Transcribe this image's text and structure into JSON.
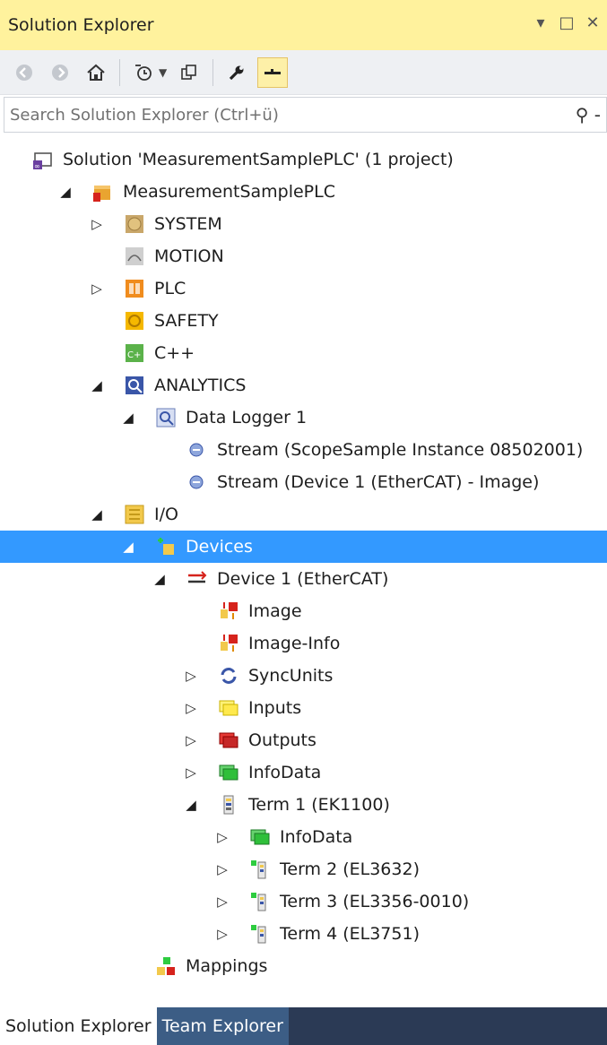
{
  "window": {
    "title": "Solution Explorer",
    "controls": [
      "▾",
      "□",
      "✕"
    ]
  },
  "search": {
    "placeholder": "Search Solution Explorer (Ctrl+ü)"
  },
  "tree": [
    {
      "label": "Solution 'MeasurementSamplePLC' (1 project)",
      "level": 0,
      "expander": "",
      "icon": "solution-icon"
    },
    {
      "label": "MeasurementSamplePLC",
      "level": 1,
      "expander": "◢",
      "icon": "project-icon"
    },
    {
      "label": "SYSTEM",
      "level": 2,
      "expander": "▷",
      "icon": "system-icon"
    },
    {
      "label": "MOTION",
      "level": 2,
      "expander": "",
      "icon": "motion-icon"
    },
    {
      "label": "PLC",
      "level": 2,
      "expander": "▷",
      "icon": "plc-icon"
    },
    {
      "label": "SAFETY",
      "level": 2,
      "expander": "",
      "icon": "safety-icon"
    },
    {
      "label": "C++",
      "level": 2,
      "expander": "",
      "icon": "cpp-icon"
    },
    {
      "label": "ANALYTICS",
      "level": 2,
      "expander": "◢",
      "icon": "analytics-icon"
    },
    {
      "label": "Data Logger 1",
      "level": 3,
      "expander": "◢",
      "icon": "data-logger-icon"
    },
    {
      "label": "Stream (ScopeSample Instance 08502001)",
      "level": 4,
      "expander": "",
      "icon": "stream-icon"
    },
    {
      "label": "Stream (Device 1 (EtherCAT) - Image)",
      "level": 4,
      "expander": "",
      "icon": "stream-icon"
    },
    {
      "label": "I/O",
      "level": 2,
      "expander": "◢",
      "icon": "io-icon"
    },
    {
      "label": "Devices",
      "level": 3,
      "expander": "◢",
      "icon": "devices-icon",
      "selected": true
    },
    {
      "label": "Device 1 (EtherCAT)",
      "level": 4,
      "expander": "◢",
      "icon": "ethercat-device-icon"
    },
    {
      "label": "Image",
      "level": 5,
      "expander": "",
      "icon": "image-icon"
    },
    {
      "label": "Image-Info",
      "level": 5,
      "expander": "",
      "icon": "image-info-icon"
    },
    {
      "label": "SyncUnits",
      "level": 5,
      "expander": "▷",
      "icon": "sync-units-icon"
    },
    {
      "label": "Inputs",
      "level": 5,
      "expander": "▷",
      "icon": "inputs-icon"
    },
    {
      "label": "Outputs",
      "level": 5,
      "expander": "▷",
      "icon": "outputs-icon"
    },
    {
      "label": "InfoData",
      "level": 5,
      "expander": "▷",
      "icon": "infodata-icon"
    },
    {
      "label": "Term 1 (EK1100)",
      "level": 5,
      "expander": "◢",
      "icon": "terminal-icon"
    },
    {
      "label": "InfoData",
      "level": 6,
      "expander": "▷",
      "icon": "infodata-icon"
    },
    {
      "label": "Term 2 (EL3632)",
      "level": 6,
      "expander": "▷",
      "icon": "terminal-green-icon"
    },
    {
      "label": "Term 3 (EL3356-0010)",
      "level": 6,
      "expander": "▷",
      "icon": "terminal-green-icon"
    },
    {
      "label": "Term 4 (EL3751)",
      "level": 6,
      "expander": "▷",
      "icon": "terminal-green-icon"
    },
    {
      "label": "Mappings",
      "level": 3,
      "expander": "",
      "icon": "mappings-icon"
    }
  ],
  "footer": {
    "tabs": [
      "Solution Explorer",
      "Team Explorer"
    ]
  },
  "colors": {
    "title_bar": "#fff29d",
    "selection": "#3399ff",
    "footer": "#2b3a55"
  }
}
